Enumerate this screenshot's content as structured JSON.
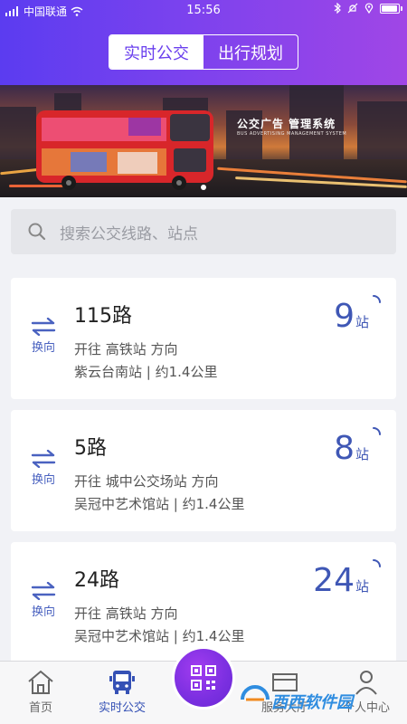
{
  "status": {
    "carrier": "中国联通",
    "time": "15:56",
    "battery_level": 0.95
  },
  "segment": {
    "active": "实时公交",
    "inactive": "出行规划"
  },
  "banner": {
    "title": "公交广告 管理系统",
    "subtitle": "BUS ADVERTISING MANAGEMENT SYSTEM"
  },
  "search": {
    "placeholder": "搜索公交线路、站点"
  },
  "cards": [
    {
      "swap_label": "换向",
      "route": "115路",
      "direction": "开往 高铁站 方向",
      "stop": "紫云台南站 | 约1.4公里",
      "count": "9",
      "unit": "站"
    },
    {
      "swap_label": "换向",
      "route": "5路",
      "direction": "开往 城中公交场站 方向",
      "stop": "吴冠中艺术馆站 | 约1.4公里",
      "count": "8",
      "unit": "站"
    },
    {
      "swap_label": "换向",
      "route": "24路",
      "direction": "开往 高铁站 方向",
      "stop": "吴冠中艺术馆站 | 约1.4公里",
      "count": "24",
      "unit": "站"
    }
  ],
  "tabs": {
    "home": "首页",
    "realtime": "实时公交",
    "service": "服务大厅",
    "profile": "个人中心"
  },
  "watermark": "西西软件园",
  "colors": {
    "accent": "#6a3fee",
    "blue": "#3f57b5",
    "fab": "#7a2fe0"
  }
}
